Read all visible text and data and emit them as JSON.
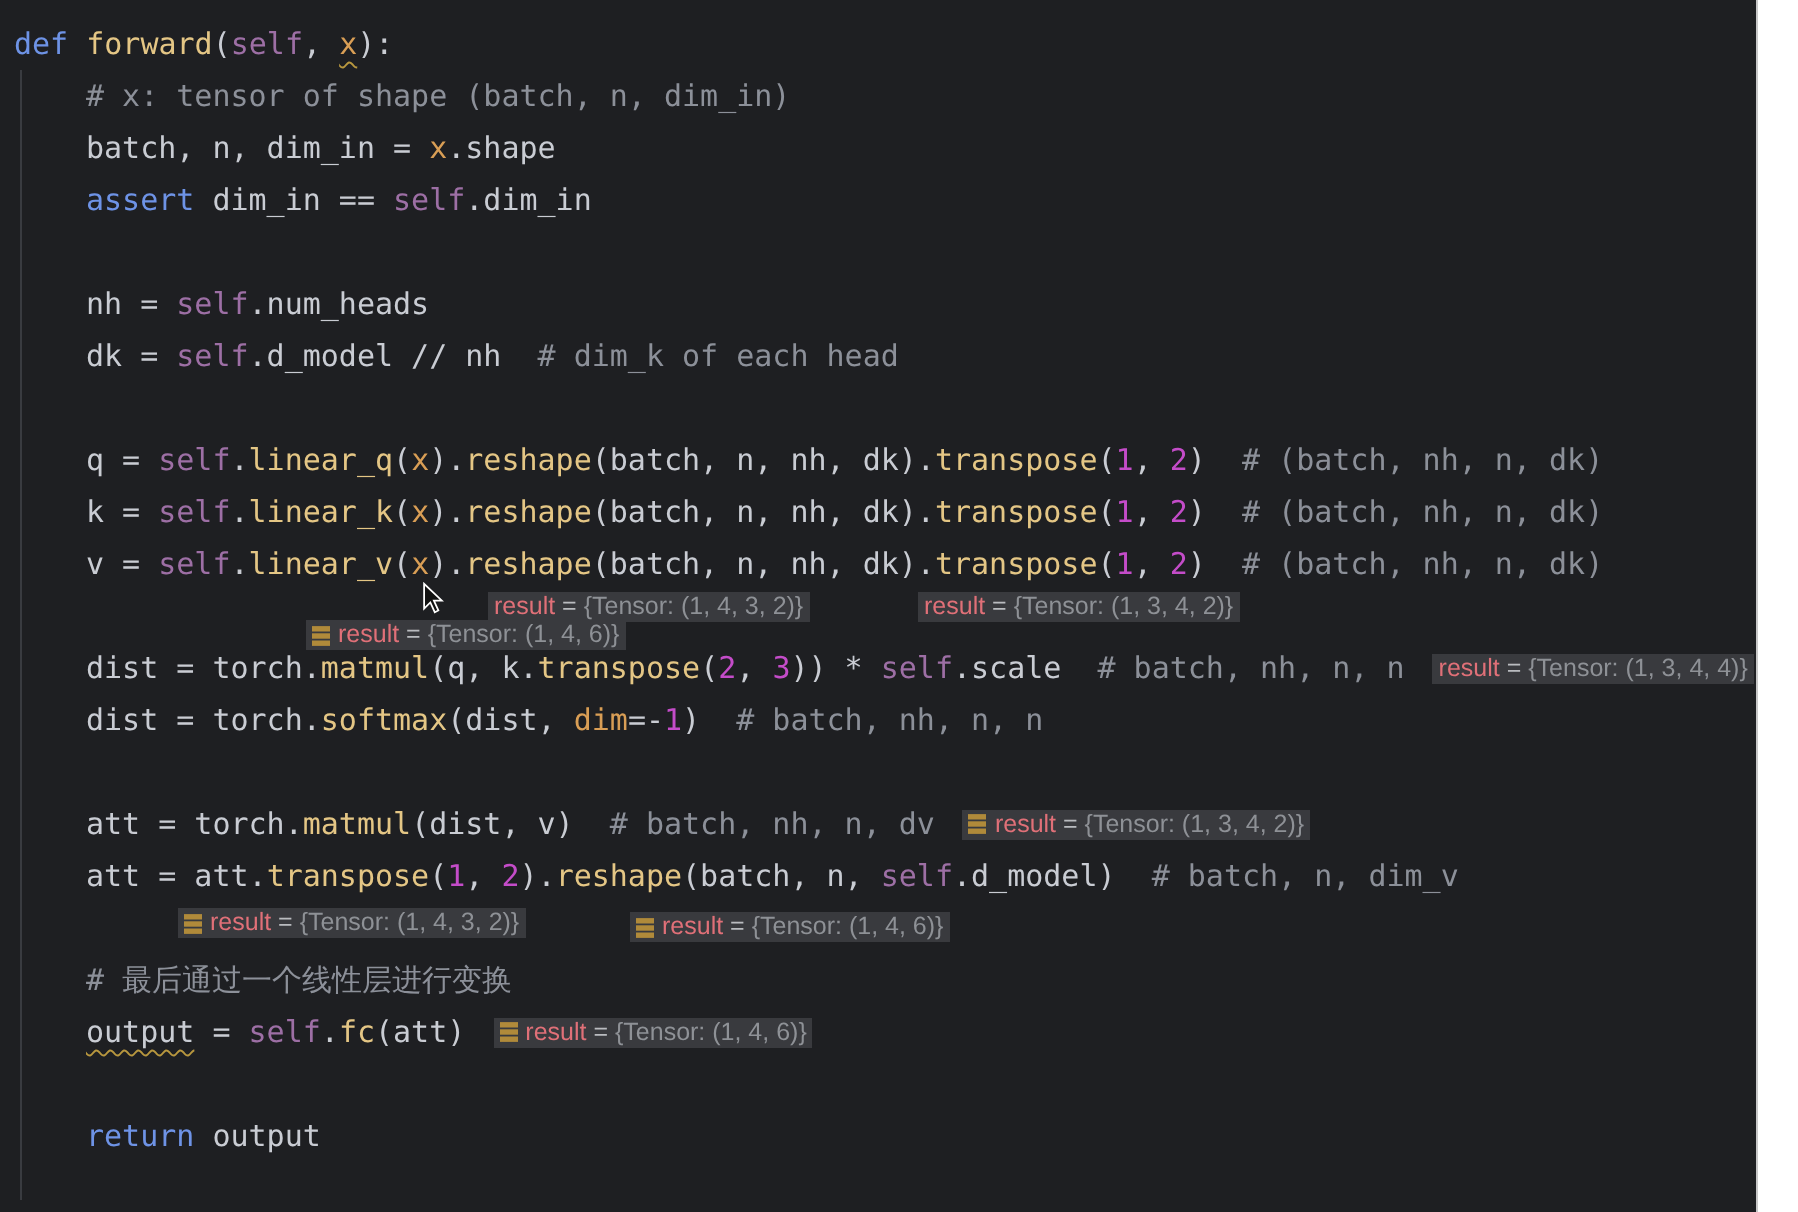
{
  "code": {
    "lines": [
      {
        "kind": "code",
        "tokens": [
          {
            "kind": "keyword",
            "text": "def"
          },
          {
            "kind": "func",
            "text": " forward"
          },
          {
            "kind": "plain",
            "text": "("
          },
          {
            "kind": "self",
            "text": "self"
          },
          {
            "kind": "plain",
            "text": ", "
          },
          {
            "kind": "param",
            "text": "x",
            "squiggle": true
          },
          {
            "kind": "plain",
            "text": "):"
          }
        ],
        "children": [
          {
            "kind": "code",
            "tokens": [
              {
                "kind": "comment",
                "text": "# x: tensor of shape (batch, n, dim_in)"
              }
            ]
          },
          {
            "kind": "code",
            "tokens": [
              {
                "kind": "plain",
                "text": "batch, n, dim_in = "
              },
              {
                "kind": "param",
                "text": "x"
              },
              {
                "kind": "plain",
                "text": ".shape"
              }
            ]
          },
          {
            "kind": "code",
            "tokens": [
              {
                "kind": "keyword",
                "text": "assert"
              },
              {
                "kind": "plain",
                "text": " dim_in == "
              },
              {
                "kind": "self",
                "text": "self"
              },
              {
                "kind": "plain",
                "text": ".dim_in"
              }
            ]
          },
          {
            "kind": "blank"
          },
          {
            "kind": "code",
            "tokens": [
              {
                "kind": "plain",
                "text": "nh = "
              },
              {
                "kind": "self",
                "text": "self"
              },
              {
                "kind": "plain",
                "text": ".num_heads"
              }
            ]
          },
          {
            "kind": "code",
            "tokens": [
              {
                "kind": "plain",
                "text": "dk = "
              },
              {
                "kind": "self",
                "text": "self"
              },
              {
                "kind": "plain",
                "text": ".d_model // nh  "
              },
              {
                "kind": "comment",
                "text": "# dim_k of each head"
              }
            ]
          },
          {
            "kind": "blank"
          },
          {
            "kind": "code",
            "tokens": [
              {
                "kind": "plain",
                "text": "q = "
              },
              {
                "kind": "self",
                "text": "self"
              },
              {
                "kind": "plain",
                "text": "."
              },
              {
                "kind": "func",
                "text": "linear_q"
              },
              {
                "kind": "plain",
                "text": "("
              },
              {
                "kind": "param",
                "text": "x"
              },
              {
                "kind": "plain",
                "text": ")."
              },
              {
                "kind": "func",
                "text": "reshape"
              },
              {
                "kind": "plain",
                "text": "(batch, n, nh, dk)."
              },
              {
                "kind": "func",
                "text": "transpose"
              },
              {
                "kind": "plain",
                "text": "("
              },
              {
                "kind": "number",
                "text": "1"
              },
              {
                "kind": "plain",
                "text": ", "
              },
              {
                "kind": "number",
                "text": "2"
              },
              {
                "kind": "plain",
                "text": ")  "
              },
              {
                "kind": "comment",
                "text": "# (batch, nh, n, dk)"
              }
            ]
          },
          {
            "kind": "code",
            "tokens": [
              {
                "kind": "plain",
                "text": "k = "
              },
              {
                "kind": "self",
                "text": "self"
              },
              {
                "kind": "plain",
                "text": "."
              },
              {
                "kind": "func",
                "text": "linear_k"
              },
              {
                "kind": "plain",
                "text": "("
              },
              {
                "kind": "param",
                "text": "x"
              },
              {
                "kind": "plain",
                "text": ")."
              },
              {
                "kind": "func",
                "text": "reshape"
              },
              {
                "kind": "plain",
                "text": "(batch, n, nh, dk)."
              },
              {
                "kind": "func",
                "text": "transpose"
              },
              {
                "kind": "plain",
                "text": "("
              },
              {
                "kind": "number",
                "text": "1"
              },
              {
                "kind": "plain",
                "text": ", "
              },
              {
                "kind": "number",
                "text": "2"
              },
              {
                "kind": "plain",
                "text": ")  "
              },
              {
                "kind": "comment",
                "text": "# (batch, nh, n, dk)"
              }
            ]
          },
          {
            "kind": "code",
            "tokens": [
              {
                "kind": "plain",
                "text": "v = "
              },
              {
                "kind": "self",
                "text": "self"
              },
              {
                "kind": "plain",
                "text": "."
              },
              {
                "kind": "func",
                "text": "linear_v"
              },
              {
                "kind": "plain",
                "text": "("
              },
              {
                "kind": "param",
                "text": "x"
              },
              {
                "kind": "plain",
                "text": ")."
              },
              {
                "kind": "func",
                "text": "reshape"
              },
              {
                "kind": "plain",
                "text": "(batch, n, nh, dk)."
              },
              {
                "kind": "func",
                "text": "transpose"
              },
              {
                "kind": "plain",
                "text": "("
              },
              {
                "kind": "number",
                "text": "1"
              },
              {
                "kind": "plain",
                "text": ", "
              },
              {
                "kind": "number",
                "text": "2"
              },
              {
                "kind": "plain",
                "text": ")  "
              },
              {
                "kind": "comment",
                "text": "# (batch, nh, n, dk)"
              }
            ]
          },
          {
            "kind": "blank",
            "hints": [
              {
                "name": "result",
                "operator": "=",
                "value": "{Tensor: (1, 4, 3, 2)}",
                "icon": false
              },
              {
                "name": "result",
                "operator": "=",
                "value": "{Tensor: (1, 3, 4, 2)}",
                "icon": false
              },
              {
                "name": "result",
                "operator": "=",
                "value": "{Tensor: (1, 4, 6)}",
                "icon": true
              }
            ]
          },
          {
            "kind": "code",
            "tokens": [
              {
                "kind": "plain",
                "text": "dist = torch."
              },
              {
                "kind": "func",
                "text": "matmul"
              },
              {
                "kind": "plain",
                "text": "(q, k."
              },
              {
                "kind": "func",
                "text": "transpose"
              },
              {
                "kind": "plain",
                "text": "("
              },
              {
                "kind": "number",
                "text": "2"
              },
              {
                "kind": "plain",
                "text": ", "
              },
              {
                "kind": "number",
                "text": "3"
              },
              {
                "kind": "plain",
                "text": ")) * "
              },
              {
                "kind": "self",
                "text": "self"
              },
              {
                "kind": "plain",
                "text": ".scale  "
              },
              {
                "kind": "comment",
                "text": "# batch, nh, n, n"
              }
            ],
            "hints": [
              {
                "name": "result",
                "operator": "=",
                "value": "{Tensor: (1, 3, 4, 4)}",
                "icon": false
              }
            ]
          },
          {
            "kind": "code",
            "tokens": [
              {
                "kind": "plain",
                "text": "dist = torch."
              },
              {
                "kind": "func",
                "text": "softmax"
              },
              {
                "kind": "plain",
                "text": "(dist, "
              },
              {
                "kind": "kwarg",
                "text": "dim"
              },
              {
                "kind": "plain",
                "text": "=-"
              },
              {
                "kind": "number",
                "text": "1"
              },
              {
                "kind": "plain",
                "text": ")  "
              },
              {
                "kind": "comment",
                "text": "# batch, nh, n, n"
              }
            ]
          },
          {
            "kind": "blank"
          },
          {
            "kind": "code",
            "tokens": [
              {
                "kind": "plain",
                "text": "att = torch."
              },
              {
                "kind": "func",
                "text": "matmul"
              },
              {
                "kind": "plain",
                "text": "(dist, v)  "
              },
              {
                "kind": "comment",
                "text": "# batch, nh, n, dv"
              }
            ],
            "hints": [
              {
                "name": "result",
                "operator": "=",
                "value": "{Tensor: (1, 3, 4, 2)}",
                "icon": true
              }
            ]
          },
          {
            "kind": "code",
            "tokens": [
              {
                "kind": "plain",
                "text": "att = att."
              },
              {
                "kind": "func",
                "text": "transpose"
              },
              {
                "kind": "plain",
                "text": "("
              },
              {
                "kind": "number",
                "text": "1"
              },
              {
                "kind": "plain",
                "text": ", "
              },
              {
                "kind": "number",
                "text": "2"
              },
              {
                "kind": "plain",
                "text": ")."
              },
              {
                "kind": "func",
                "text": "reshape"
              },
              {
                "kind": "plain",
                "text": "(batch, n, "
              },
              {
                "kind": "self",
                "text": "self"
              },
              {
                "kind": "plain",
                "text": ".d_model)  "
              },
              {
                "kind": "comment",
                "text": "# batch, n, dim_v"
              }
            ]
          },
          {
            "kind": "blank",
            "hints": [
              {
                "name": "result",
                "operator": "=",
                "value": "{Tensor: (1, 4, 3, 2)}",
                "icon": true
              },
              {
                "name": "result",
                "operator": "=",
                "value": "{Tensor: (1, 4, 6)}",
                "icon": true
              }
            ]
          },
          {
            "kind": "code",
            "tokens": [
              {
                "kind": "comment",
                "text": "# 最后通过一个线性层进行变换"
              }
            ]
          },
          {
            "kind": "code",
            "tokens": [
              {
                "kind": "plain",
                "text": "output",
                "squiggle": true
              },
              {
                "kind": "plain",
                "text": " = "
              },
              {
                "kind": "self",
                "text": "self"
              },
              {
                "kind": "plain",
                "text": "."
              },
              {
                "kind": "func",
                "text": "fc"
              },
              {
                "kind": "plain",
                "text": "(att)"
              }
            ],
            "hints": [
              {
                "name": "result",
                "operator": "=",
                "value": "{Tensor: (1, 4, 6)}",
                "icon": true
              }
            ]
          },
          {
            "kind": "blank"
          },
          {
            "kind": "code",
            "tokens": [
              {
                "kind": "keyword",
                "text": "return"
              },
              {
                "kind": "plain",
                "text": " output"
              }
            ]
          }
        ]
      }
    ]
  }
}
